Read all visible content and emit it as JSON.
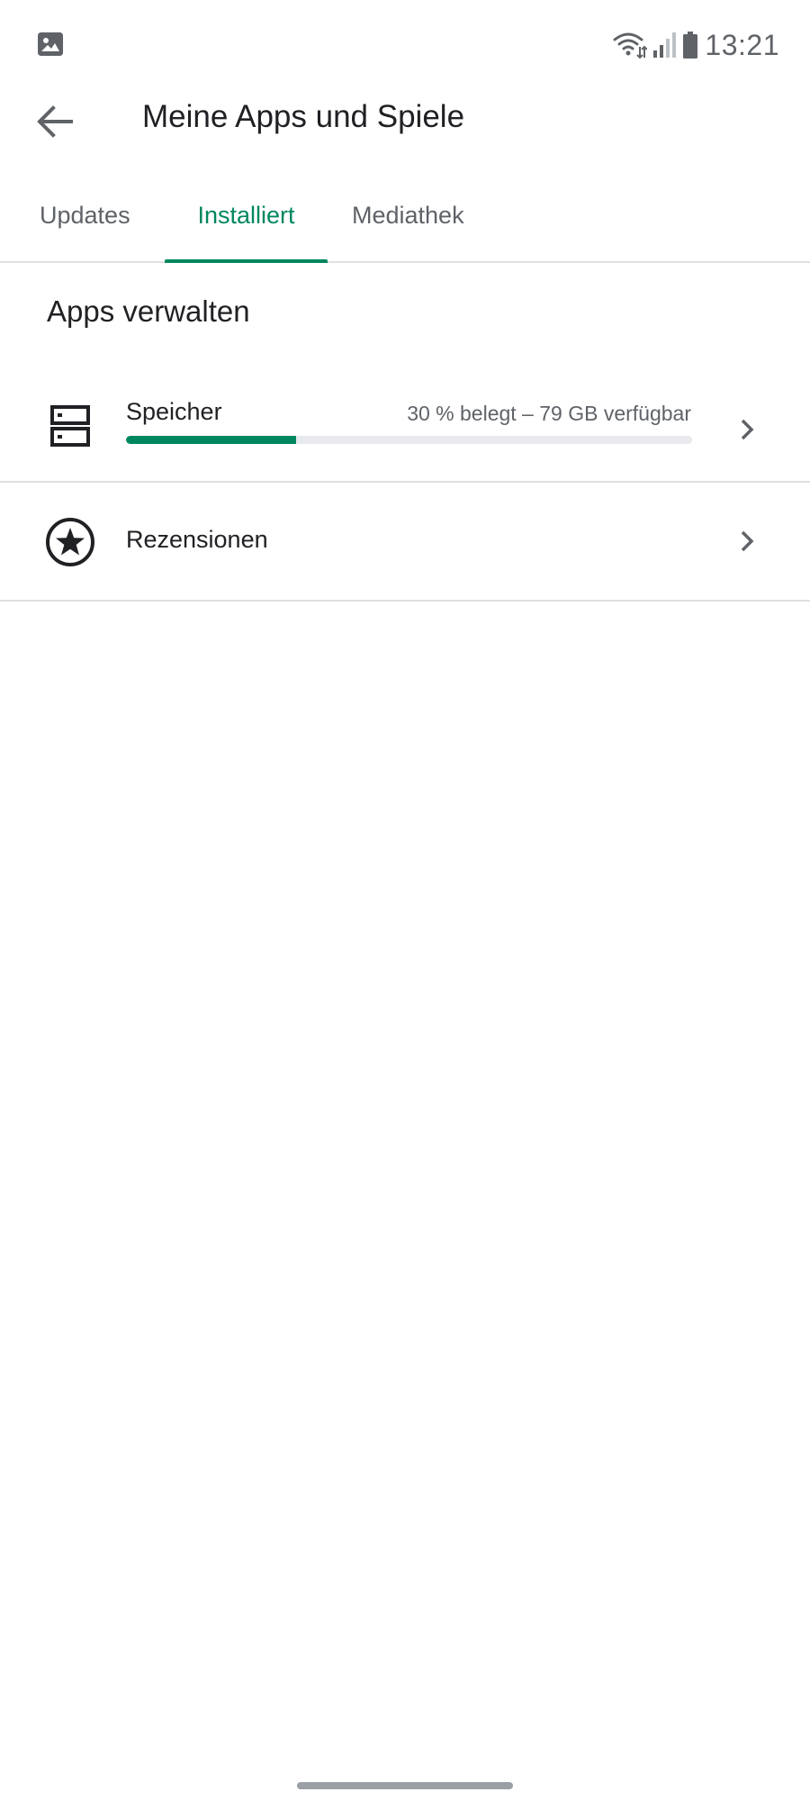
{
  "status_bar": {
    "time": "13:21",
    "icons": [
      "gallery-icon",
      "wifi-icon",
      "signal-icon",
      "battery-icon"
    ]
  },
  "app_bar": {
    "title": "Meine Apps und Spiele",
    "back_icon": "arrow-back-icon"
  },
  "tabs": [
    {
      "label": "Updates",
      "active": false
    },
    {
      "label": "Installiert",
      "active": true
    },
    {
      "label": "Mediathek",
      "active": false
    }
  ],
  "section": {
    "title": "Apps verwalten"
  },
  "storage": {
    "label": "Speicher",
    "info": "30 % belegt – 79 GB verfügbar",
    "used_fraction": 0.3,
    "icon": "storage-icon"
  },
  "reviews": {
    "label": "Rezensionen",
    "icon": "star-circle-icon"
  },
  "colors": {
    "accent": "#01875f",
    "text_primary": "#202124",
    "text_secondary": "#5f6368",
    "divider": "#e0e0e0"
  }
}
